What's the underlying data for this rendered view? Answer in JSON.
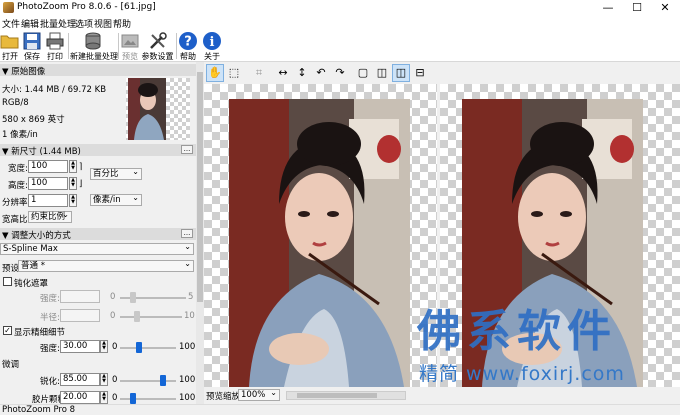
{
  "window": {
    "title": "PhotoZoom Pro 8.0.6 - [61.jpg]",
    "minimize": "—",
    "maximize": "☐",
    "close": "✕"
  },
  "menu": [
    "文件",
    "编辑",
    "批量处理",
    "选项",
    "视图",
    "帮助"
  ],
  "toolbar": {
    "open": "打开",
    "save": "保存",
    "print": "打印",
    "batch": "新建批量处理",
    "preview": "预览",
    "params": "参数设置",
    "help": "帮助",
    "about": "关于"
  },
  "original": {
    "header": "▼ 原始图像",
    "size": "大小: 1.44 MB / 69.72 KB",
    "mode": "RGB/8",
    "dims": "580 x 869 英寸",
    "res": "1 像素/in"
  },
  "newsize": {
    "header": "▼ 新尺寸 (1.44 MB)",
    "dots": "...",
    "width_label": "宽度:",
    "width_value": "100",
    "height_label": "高度:",
    "height_value": "100",
    "unit": "百分比",
    "res_label": "分辨率:",
    "res_value": "1",
    "res_unit": "像素/in",
    "aspect_label": "宽高比:",
    "aspect_value": "约束比例"
  },
  "method": {
    "header": "▼ 调整大小的方式",
    "dots": "...",
    "algorithm": "S-Spline Max",
    "preset_label": "预设:",
    "preset_value": "普通 *"
  },
  "unsharp": {
    "label": "钝化遮罩",
    "strength_label": "强度:",
    "strength_value": "0",
    "strength_max": "5",
    "radius_label": "半径:",
    "radius_value": "0",
    "radius_max": "10"
  },
  "fine": {
    "label": "显示精细细节",
    "check": "✓",
    "strength_label": "强度:",
    "strength_value": "30.00",
    "strength_min": "0",
    "strength_max": "100"
  },
  "micro": {
    "header": "微调",
    "sharpen_label": "锐化:",
    "sharpen_value": "85.00",
    "sharpen_min": "0",
    "sharpen_max": "100",
    "grain_label": "胶片颗粒:",
    "grain_value": "20.00",
    "grain_min": "0",
    "grain_max": "100"
  },
  "zoom": {
    "label": "预览缩放:",
    "value": "100%"
  },
  "status": "PhotoZoom Pro 8",
  "watermark": {
    "big": "佛系软件",
    "small": "精简  www.foxirj.com"
  }
}
